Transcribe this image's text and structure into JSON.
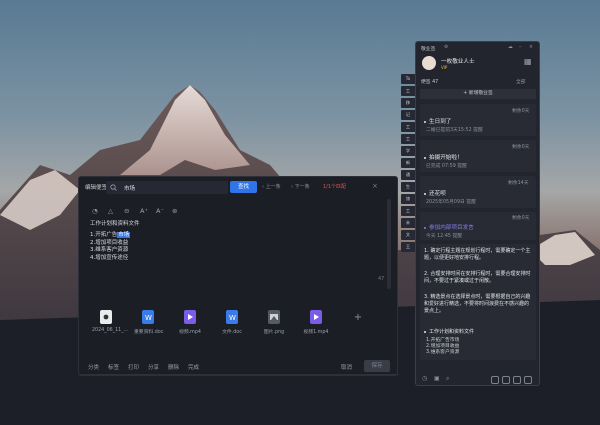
{
  "editor": {
    "title": "编辑便签",
    "search_value": "市场",
    "find_label": "查找",
    "prev_label": "上一条",
    "next_label": "下一条",
    "match_label": "1/1个匹配",
    "close_icon": "close-icon",
    "content_title": "工作计划和资料文件",
    "items": [
      {
        "pre": "1.开拓广告",
        "hl": "市场",
        "post": ""
      },
      {
        "pre": "2.增加项目收益",
        "hl": "",
        "post": ""
      },
      {
        "pre": "3.维系客户资源",
        "hl": "",
        "post": ""
      },
      {
        "pre": "4.增加宣传途径",
        "hl": "",
        "post": ""
      }
    ],
    "char_count": "47",
    "files": [
      {
        "name": "2024_06_11_...",
        "color": "#e9ecef",
        "icon": "record-icon"
      },
      {
        "name": "重要资料.doc",
        "color": "#3a7bea",
        "icon": "word-icon"
      },
      {
        "name": "视频.mp4",
        "color": "#7a5ce6",
        "icon": "video-icon"
      },
      {
        "name": "文件.doc",
        "color": "#3a7bea",
        "icon": "word-icon"
      },
      {
        "name": "图片.png",
        "color": "#555a63",
        "icon": "image-icon"
      },
      {
        "name": "视频1.mp4",
        "color": "#7a5ce6",
        "icon": "video-icon"
      }
    ],
    "bottom": [
      "分类",
      "标签",
      "打印",
      "分享",
      "删除",
      "完成"
    ],
    "cancel_label": "取消",
    "save_label": "保存"
  },
  "side_tabs": [
    "To",
    "工",
    "移",
    "记",
    "工",
    "工",
    "学",
    "新",
    "通",
    "生",
    "旅",
    "工",
    "未",
    "文",
    "王"
  ],
  "panel": {
    "header_title": "敬业签",
    "user_name": "一枚敬业人士",
    "user_badge": "VIP",
    "group_label": "便签 47",
    "sort_label": "全部",
    "new_button": "+ 新增敬业签",
    "notes": [
      {
        "meta": "剩余0天",
        "title": "生日到了",
        "sub": "二婚已提前3天15:52 提醒",
        "color": "#e6e9ee"
      },
      {
        "meta": "剩余0天",
        "title": "拍摄开始啦！",
        "sub": "已完成 07:59 提醒",
        "color": "#e6e9ee"
      },
      {
        "meta": "剩余14天",
        "title": "还花呗",
        "sub": "2025年05月09日 提醒",
        "color": "#e6e9ee"
      },
      {
        "meta": "剩余0天",
        "title": "参加内部项目发言",
        "sub": "今天 12:45 提醒",
        "color": "#8a7ef0"
      }
    ],
    "para1": "1. 确定行程主题在规划行程时，需要确定一个主题，以便更好地安排行程。",
    "para2": "2. 合理安排时间在安排行程时，需要合理安排时间，不要过于紧凑或过于闲散。",
    "para3": "3. 精选景点在选择景点时，需要根据自己的兴趣和爱好进行精选，不要将时间浪费在不感兴趣的景点上。",
    "tail_title": "工作计划和资料文件",
    "tail_items": [
      "1.开拓广告市场",
      "2.增加项目收益",
      "3.维系客户资源"
    ]
  },
  "colors": {
    "accent": "#2f74e8",
    "danger": "#e0524f",
    "purple": "#8a7ef0"
  }
}
